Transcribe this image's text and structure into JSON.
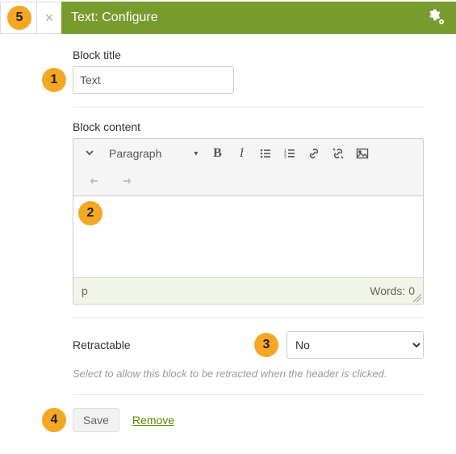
{
  "header": {
    "title": "Text: Configure"
  },
  "block_title": {
    "label": "Block title",
    "value": "Text"
  },
  "block_content": {
    "label": "Block content",
    "format_label": "Paragraph",
    "path": "p",
    "words_label": "Words: 0"
  },
  "retractable": {
    "label": "Retractable",
    "value": "No",
    "help": "Select to allow this block to be retracted when the header is clicked."
  },
  "actions": {
    "save": "Save",
    "remove": "Remove"
  },
  "markers": {
    "m1": "1",
    "m2": "2",
    "m3": "3",
    "m4": "4",
    "m5": "5"
  }
}
